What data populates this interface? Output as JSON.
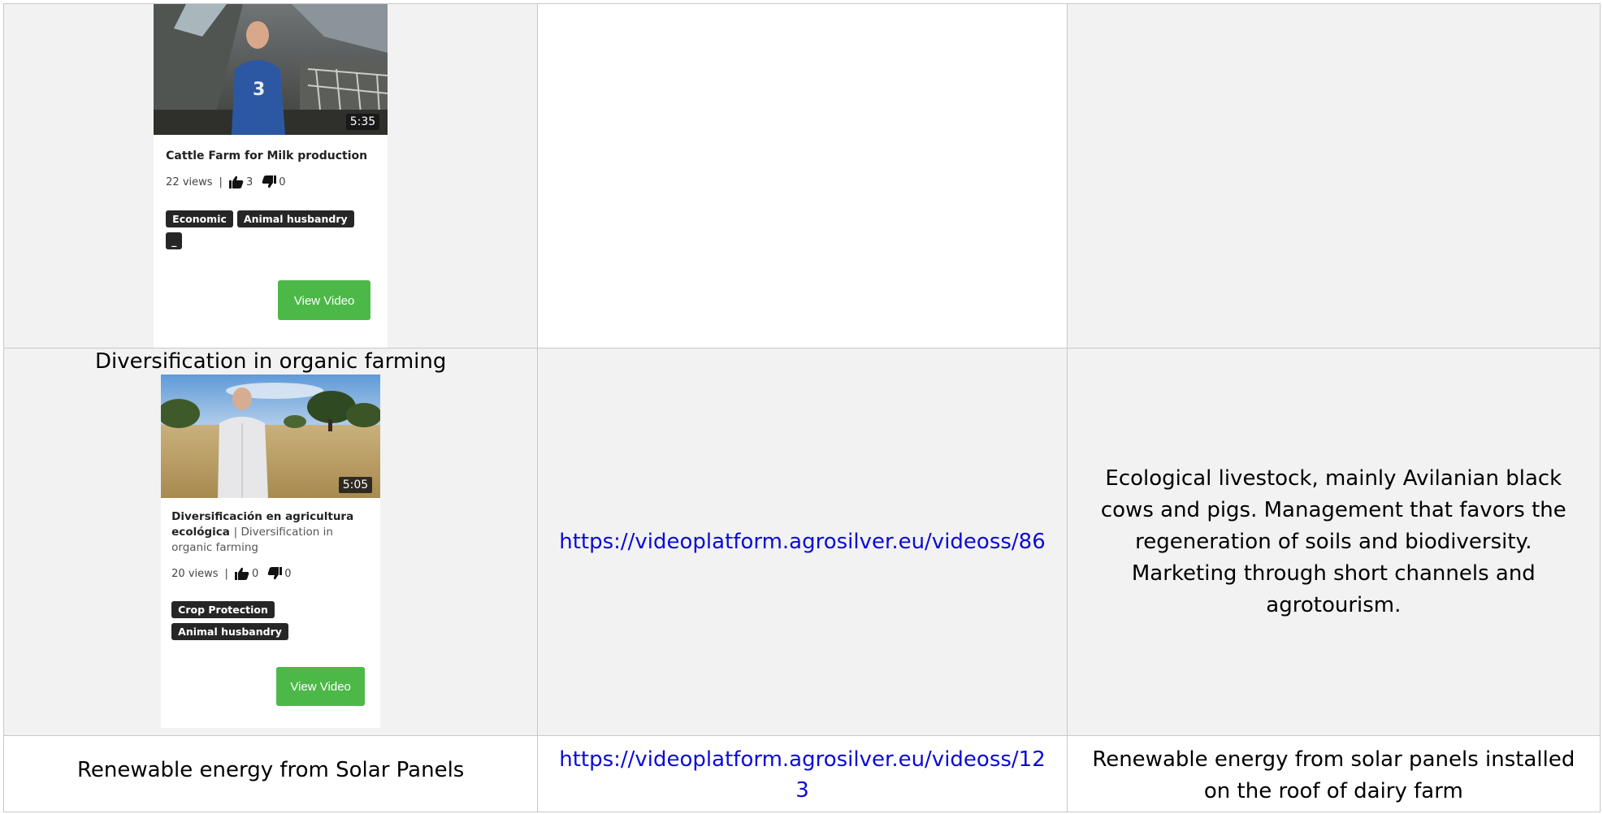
{
  "rows": [
    {
      "card": {
        "duration": "5:35",
        "title": "Cattle Farm for Milk production",
        "views": "22 views",
        "likes": "3",
        "dislikes": "0",
        "tags": [
          "Economic",
          "Animal husbandry",
          "_"
        ],
        "button": "View Video"
      }
    },
    {
      "title": "Diversification in organic farming",
      "card": {
        "duration": "5:05",
        "title": "Diversificación en agricultura ecológica",
        "subtitle": "| Diversification in organic farming",
        "views": "20 views",
        "likes": "0",
        "dislikes": "0",
        "tags": [
          "Crop Protection",
          "Animal husbandry"
        ],
        "button": "View Video"
      },
      "link": "https://videoplatform.agrosilver.eu/videoss/86",
      "description": "Ecological livestock, mainly Avilanian black cows and pigs. Management that favors the regeneration of soils and biodiversity. Marketing through short channels and agrotourism."
    },
    {
      "title": "Renewable energy from Solar Panels",
      "link_line1": "https://videoplatform.agrosilver.eu/videoss/12",
      "link_line2": "3",
      "description": "Renewable energy from solar panels installed on the roof of dairy farm"
    }
  ],
  "colors": {
    "link": "#0b0bd6",
    "button": "#4cb848",
    "tag_bg": "#262626",
    "cell_gray": "#f2f2f2"
  },
  "icons": [
    "thumbs-up-icon",
    "thumbs-down-icon"
  ]
}
